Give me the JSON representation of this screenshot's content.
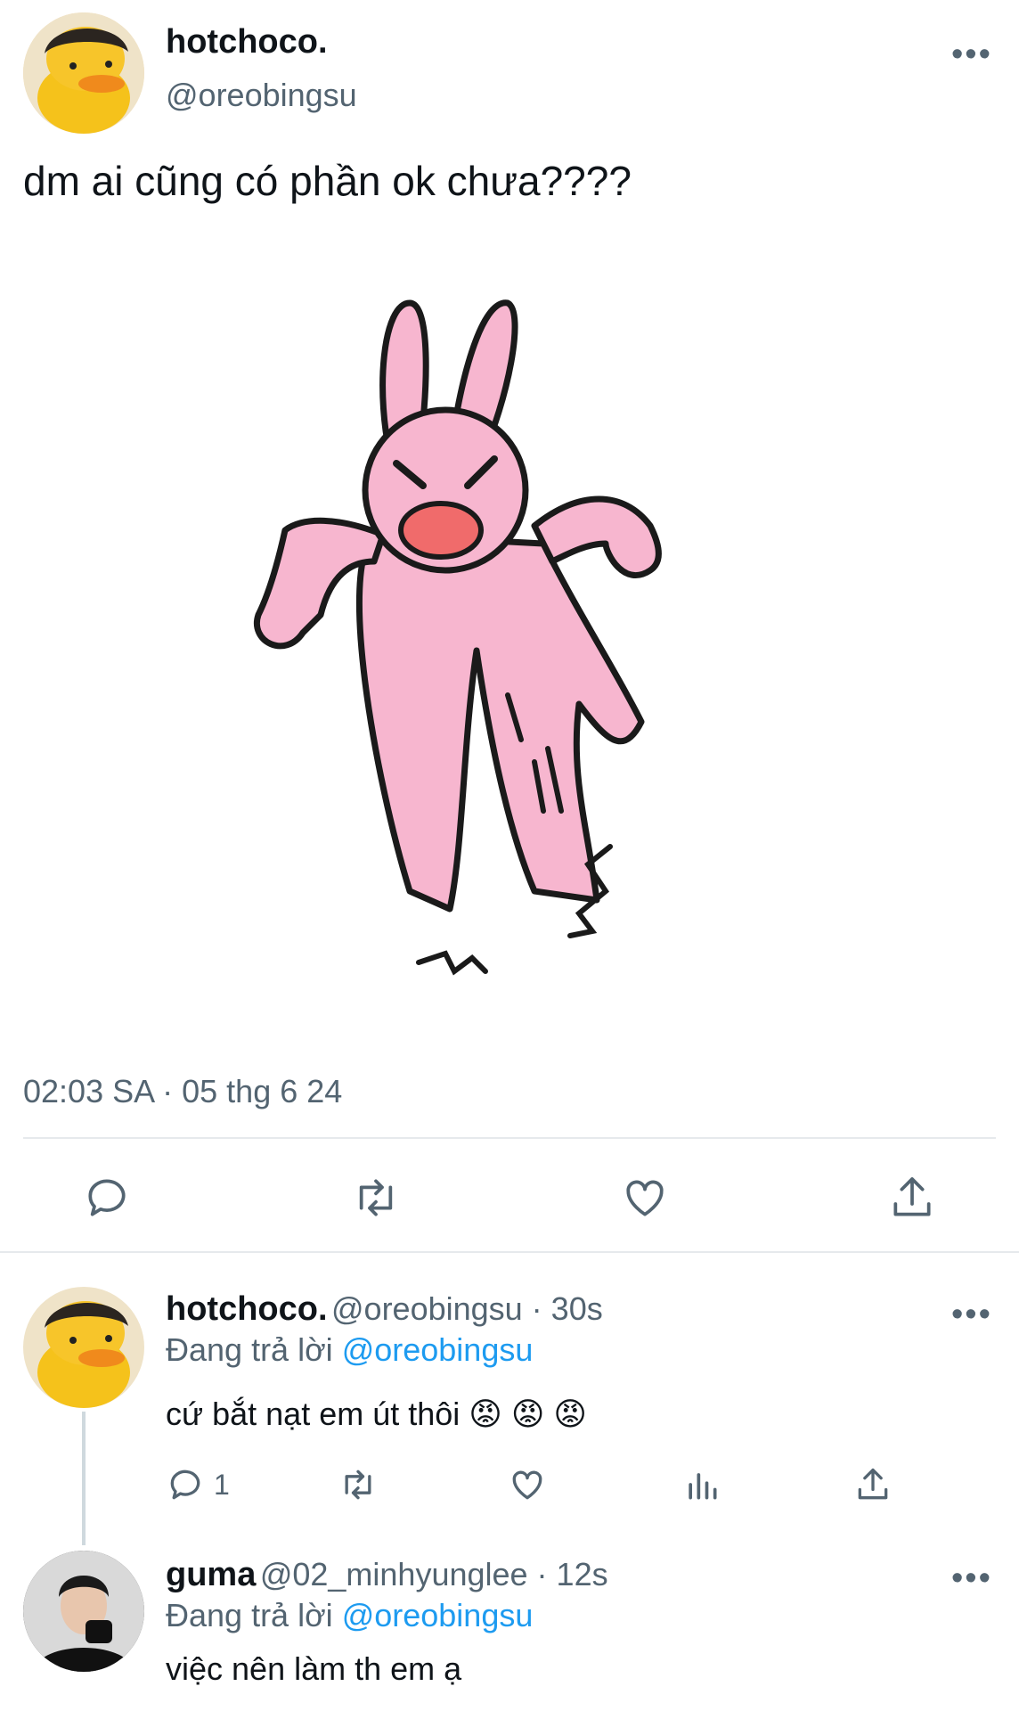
{
  "tweet": {
    "author_name": "hotchoco.",
    "author_handle": "@oreobingsu",
    "text": "dm ai cũng có phần ok chưa????",
    "timestamp": "02:03 SA · 05 thg 6 24",
    "more": "•••"
  },
  "replies": [
    {
      "author_name": "hotchoco.",
      "handle_time": "@oreobingsu · 30s",
      "replying_prefix": "Đang trả lời ",
      "replying_to": "@oreobingsu",
      "text": "cứ bắt nạt em út thôi",
      "emojis": [
        "😡",
        "😡",
        "😡"
      ],
      "reply_count": "1",
      "more": "•••"
    },
    {
      "author_name": "guma",
      "handle_time": "@02_minhyunglee · 12s",
      "replying_prefix": "Đang trả lời ",
      "replying_to": "@oreobingsu",
      "text": "việc nên làm th em ạ",
      "more": "•••"
    }
  ],
  "colors": {
    "accent": "#1d9bf0",
    "muted": "#536471",
    "divider": "#e6e9ec"
  }
}
